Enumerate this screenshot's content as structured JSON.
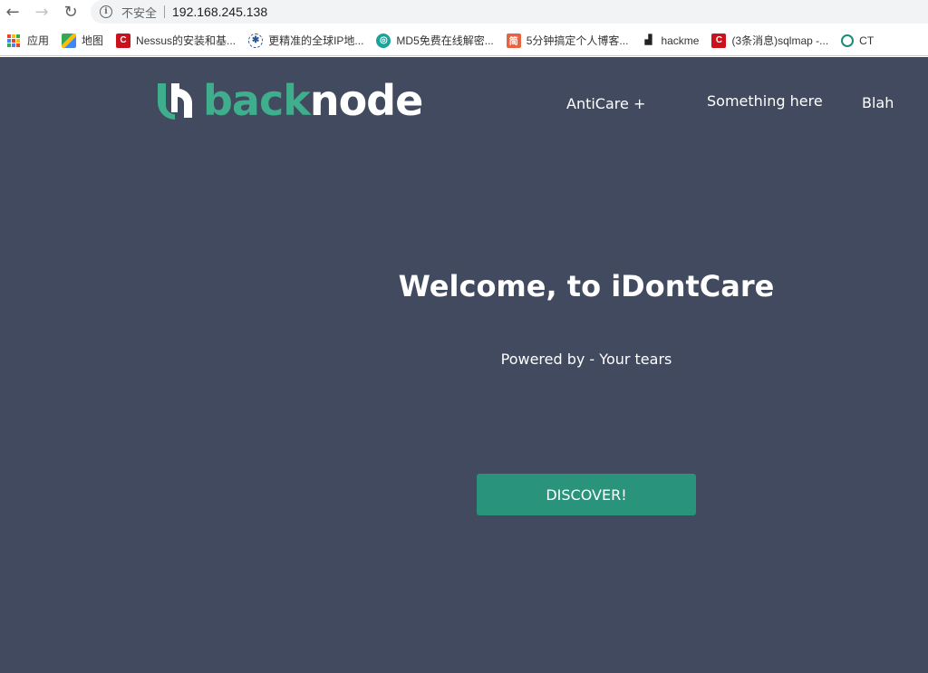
{
  "browser": {
    "security_label": "不安全",
    "url": "192.168.245.138"
  },
  "bookmarks": [
    {
      "label": "应用",
      "icon": "apps-grid-icon"
    },
    {
      "label": "地图",
      "icon": "maps-icon"
    },
    {
      "label": "Nessus的安装和基...",
      "icon": "csdn-icon",
      "color": "#c9121b"
    },
    {
      "label": "更精准的全球IP地...",
      "icon": "ip-icon"
    },
    {
      "label": "MD5免费在线解密...",
      "icon": "md5-icon",
      "color": "#1aa39b"
    },
    {
      "label": "5分钟搞定个人博客...",
      "icon": "jianshu-icon",
      "color": "#e8633f"
    },
    {
      "label": "hackme",
      "icon": "hackme-icon"
    },
    {
      "label": "(3条消息)sqlmap -...",
      "icon": "csdn-icon",
      "color": "#c9121b"
    },
    {
      "label": "CT",
      "icon": "ct-icon"
    }
  ],
  "site": {
    "logo_part1": "back",
    "logo_part2": "node",
    "nav": [
      "AntiCare +",
      "Something here",
      "Blah"
    ],
    "title": "Welcome, to iDontCare",
    "subtitle": "Powered by - Your tears",
    "cta": "DISCOVER!"
  },
  "colors": {
    "background": "#414a5f",
    "accent": "#3fae8c",
    "button": "#2a937b"
  }
}
